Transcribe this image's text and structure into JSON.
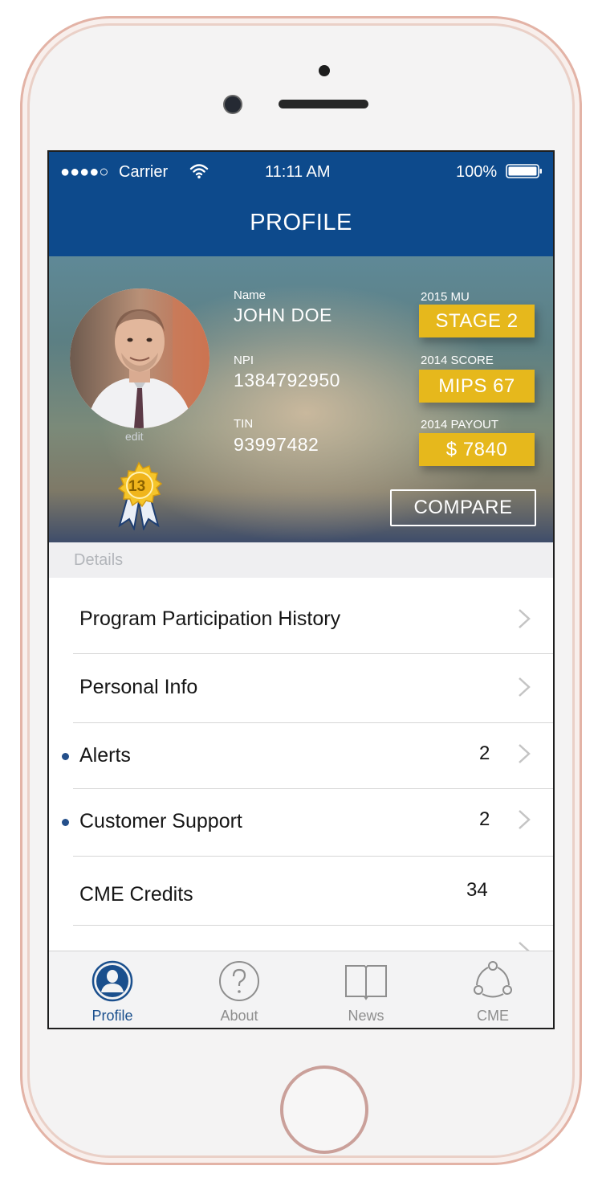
{
  "status_bar": {
    "signal": "●●●●○",
    "carrier": "Carrier",
    "time": "11:11 AM",
    "battery": "100%"
  },
  "nav": {
    "title": "PROFILE"
  },
  "profile": {
    "edit_label": "edit",
    "badge_number": "13",
    "name_label": "Name",
    "name_value": "JOHN DOE",
    "npi_label": "NPI",
    "npi_value": "1384792950",
    "tin_label": "TIN",
    "tin_value": "93997482"
  },
  "stats": [
    {
      "label": "2015 MU",
      "value": "STAGE  2"
    },
    {
      "label": "2014 SCORE",
      "value": "MIPS  67"
    },
    {
      "label": "2014 PAYOUT",
      "value": "$ 7840"
    }
  ],
  "compare_label": "COMPARE",
  "details_header": "Details",
  "list": {
    "program_history": "Program Participation History",
    "personal_info": "Personal Info",
    "alerts": "Alerts",
    "alerts_count": "2",
    "support": "Customer Support",
    "support_count": "2",
    "cme_credits": "CME Credits",
    "cme_count": "34"
  },
  "tabs": {
    "profile": "Profile",
    "about": "About",
    "news": "News",
    "cme": "CME"
  },
  "colors": {
    "brand_blue": "#0d4a8c",
    "pill_yellow": "#e6b81c",
    "unread_dot": "#244f8a"
  }
}
